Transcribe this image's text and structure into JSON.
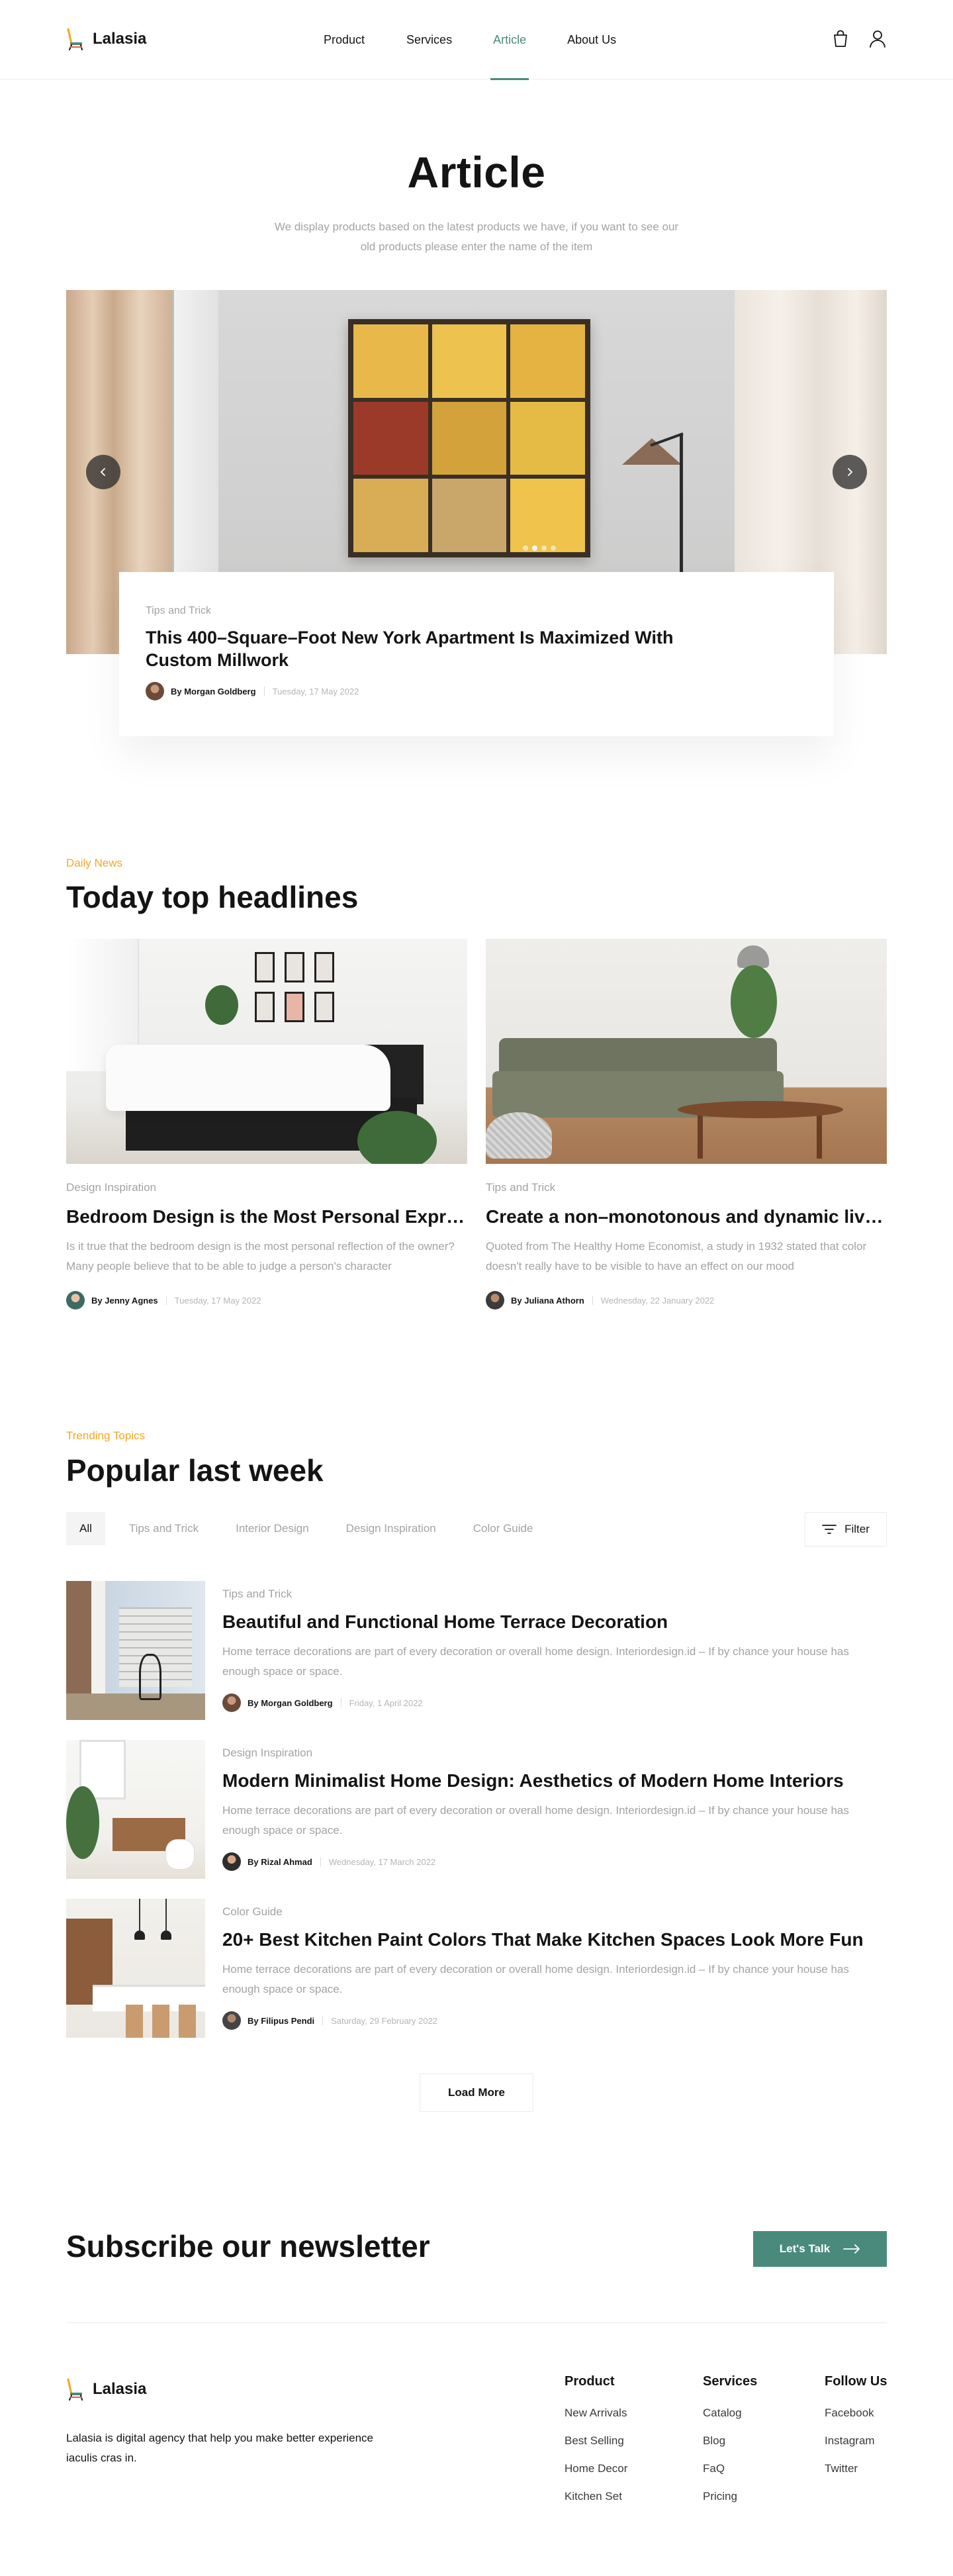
{
  "brand": {
    "name": "Lalasia",
    "accent": "#4a8a7c",
    "highlight": "#f5a623"
  },
  "nav": {
    "items": [
      {
        "label": "Product"
      },
      {
        "label": "Services"
      },
      {
        "label": "Article",
        "active": true
      },
      {
        "label": "About Us"
      }
    ],
    "icons": [
      "cart-icon",
      "user-icon"
    ]
  },
  "hero": {
    "title": "Article",
    "subtitle": "We display products based on the latest products we have, if you want to see our old products please enter the name of the item",
    "slider": {
      "slides": 4,
      "active_slide": 2
    },
    "card": {
      "category": "Tips and Trick",
      "title": "This 400–Square–Foot New York Apartment Is Maximized With Custom Millwork",
      "author": "By Morgan Goldberg",
      "date": "Tuesday, 17 May 2022"
    }
  },
  "headlines": {
    "label": "Daily News",
    "title": "Today top headlines",
    "articles": [
      {
        "category": "Design Inspiration",
        "title": "Bedroom Design is the Most Personal Expression of Style",
        "excerpt": "Is it true that the bedroom design is the most personal reflection of the owner? Many people believe that to be able to judge a person's character",
        "author": "By Jenny Agnes",
        "date": "Tuesday, 17 May 2022"
      },
      {
        "category": "Tips and Trick",
        "title": "Create a non–monotonous and dynamic living room",
        "excerpt": "Quoted from The Healthy Home Economist, a study in 1932 stated that color doesn't really have to be visible to have an effect on our mood",
        "author": "By Juliana Athorn",
        "date": "Wednesday, 22 January 2022"
      }
    ]
  },
  "popular": {
    "label": "Trending Topics",
    "title": "Popular last week",
    "filters": [
      "All",
      "Tips and Trick",
      "Interior Design",
      "Design Inspiration",
      "Color Guide"
    ],
    "active_filter": "All",
    "filter_button": "Filter",
    "articles": [
      {
        "category": "Tips and Trick",
        "title": "Beautiful and Functional Home Terrace Decoration",
        "excerpt": "Home terrace decorations are part of every decoration or overall home design. Interiordesign.id – If by chance your house has enough space or space.",
        "author": "By Morgan Goldberg",
        "date": "Friday, 1 April 2022"
      },
      {
        "category": "Design Inspiration",
        "title": "Modern Minimalist Home Design: Aesthetics of Modern Home Interiors",
        "excerpt": "Home terrace decorations are part of every decoration or overall home design. Interiordesign.id – If by chance your house has enough space or space.",
        "author": "By Rizal Ahmad",
        "date": "Wednesday, 17 March 2022"
      },
      {
        "category": "Color Guide",
        "title": "20+ Best Kitchen Paint Colors That Make Kitchen Spaces Look More Fun",
        "excerpt": "Home terrace decorations are part of every decoration or overall home design. Interiordesign.id – If by chance your house has enough space or space.",
        "author": "By Filipus Pendi",
        "date": "Saturday, 29 February 2022"
      }
    ],
    "load_more": "Load More"
  },
  "newsletter": {
    "title": "Subscribe our newsletter",
    "button": "Let's Talk"
  },
  "footer": {
    "brand": "Lalasia",
    "description": "Lalasia is digital agency that help you make better experience iaculis cras in.",
    "columns": [
      {
        "heading": "Product",
        "links": [
          "New Arrivals",
          "Best Selling",
          "Home Decor",
          "Kitchen Set"
        ]
      },
      {
        "heading": "Services",
        "links": [
          "Catalog",
          "Blog",
          "FaQ",
          "Pricing"
        ]
      },
      {
        "heading": "Follow Us",
        "links": [
          "Facebook",
          "Instagram",
          "Twitter"
        ]
      }
    ]
  }
}
